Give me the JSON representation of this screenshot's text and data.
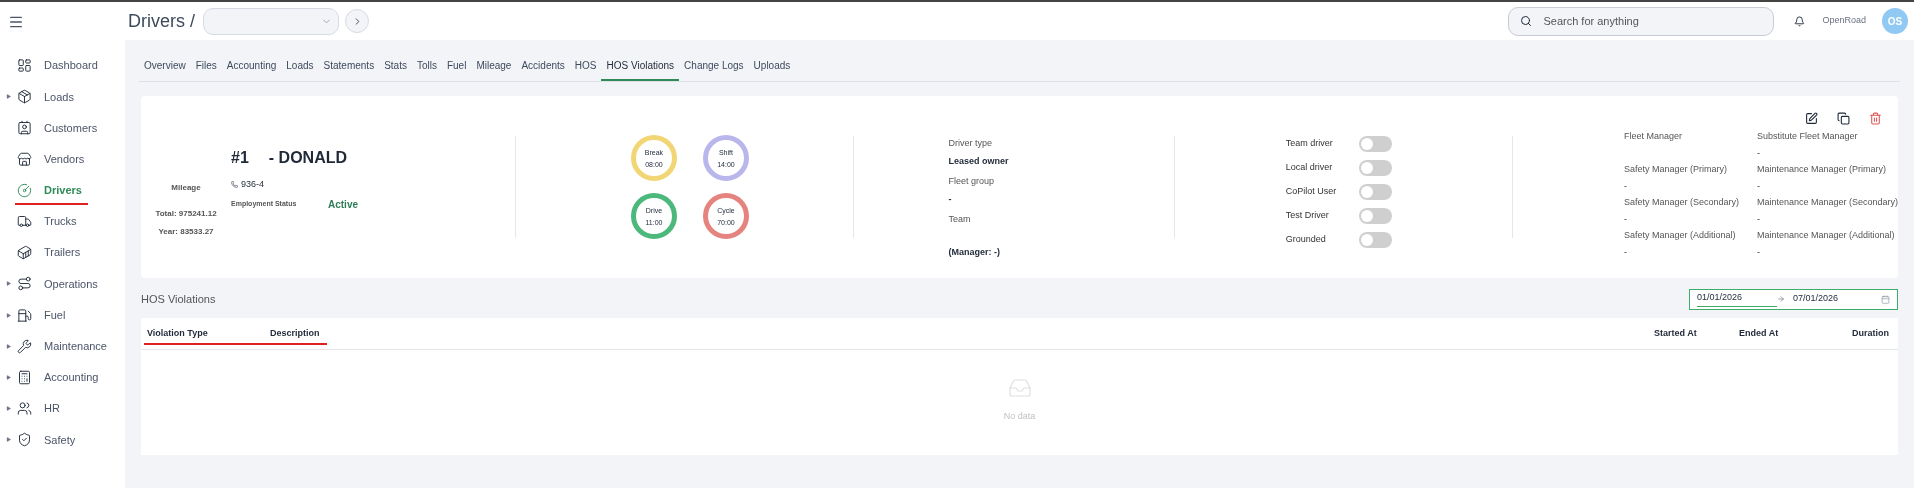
{
  "header": {
    "breadcrumb": "Drivers /",
    "search": {
      "placeholder": "Search for anything"
    },
    "company": "OpenRoad",
    "avatar_initials": "OS"
  },
  "sidebar": {
    "items": [
      {
        "label": "Dashboard",
        "expandable": false,
        "selected": false
      },
      {
        "label": "Loads",
        "expandable": true,
        "selected": false
      },
      {
        "label": "Customers",
        "expandable": false,
        "selected": false
      },
      {
        "label": "Vendors",
        "expandable": false,
        "selected": false
      },
      {
        "label": "Drivers",
        "expandable": false,
        "selected": true
      },
      {
        "label": "Trucks",
        "expandable": false,
        "selected": false
      },
      {
        "label": "Trailers",
        "expandable": false,
        "selected": false
      },
      {
        "label": "Operations",
        "expandable": true,
        "selected": false
      },
      {
        "label": "Fuel",
        "expandable": true,
        "selected": false
      },
      {
        "label": "Maintenance",
        "expandable": true,
        "selected": false
      },
      {
        "label": "Accounting",
        "expandable": true,
        "selected": false
      },
      {
        "label": "HR",
        "expandable": true,
        "selected": false
      },
      {
        "label": "Safety",
        "expandable": true,
        "selected": false
      }
    ]
  },
  "tabs": [
    {
      "label": "Overview",
      "selected": false
    },
    {
      "label": "Files",
      "selected": false
    },
    {
      "label": "Accounting",
      "selected": false
    },
    {
      "label": "Loads",
      "selected": false
    },
    {
      "label": "Statements",
      "selected": false
    },
    {
      "label": "Stats",
      "selected": false
    },
    {
      "label": "Tolls",
      "selected": false
    },
    {
      "label": "Fuel",
      "selected": false
    },
    {
      "label": "Mileage",
      "selected": false
    },
    {
      "label": "Accidents",
      "selected": false
    },
    {
      "label": "HOS",
      "selected": false
    },
    {
      "label": "HOS Violations",
      "selected": true
    },
    {
      "label": "Change Logs",
      "selected": false
    },
    {
      "label": "Uploads",
      "selected": false
    }
  ],
  "driver": {
    "name_prefix": "#1",
    "name": "- DONALD",
    "phone": "936-4",
    "employment_status_label": "Employment Status",
    "employment_status": "Active",
    "mileage_label": "Mileage",
    "mileage_total": "Total: 975241.12",
    "mileage_year": "Year: 83533.27"
  },
  "gauges": [
    {
      "label": "Break",
      "time": "08:00",
      "color": "#f2d675"
    },
    {
      "label": "Shift",
      "time": "14:00",
      "color": "#b9b6ec"
    },
    {
      "label": "Drive",
      "time": "11:00",
      "color": "#4cb87c"
    },
    {
      "label": "Cycle",
      "time": "70:00",
      "color": "#e5837f"
    }
  ],
  "details": [
    {
      "label": "Driver type",
      "value": "Leased owner"
    },
    {
      "label": "Fleet group",
      "value": "-"
    },
    {
      "label": "Team",
      "value": "(Manager: -)"
    }
  ],
  "toggles": [
    {
      "label": "Team driver",
      "on": false
    },
    {
      "label": "Local driver",
      "on": false
    },
    {
      "label": "CoPilot User",
      "on": false
    },
    {
      "label": "Test Driver",
      "on": false
    },
    {
      "label": "Grounded",
      "on": false
    }
  ],
  "managers": [
    {
      "label": "Fleet Manager"
    },
    {
      "label": "Substitute Fleet Manager",
      "value": "-"
    },
    {
      "label": "Safety Manager (Primary)",
      "value": "-"
    },
    {
      "label": "Maintenance Manager (Primary)",
      "value": "-"
    },
    {
      "label": "Safety Manager (Secondary)",
      "value": "-"
    },
    {
      "label": "Maintenance Manager (Secondary)",
      "value": "-"
    },
    {
      "label": "Safety Manager (Additional)",
      "value": "-"
    },
    {
      "label": "Maintenance Manager (Additional)",
      "value": "-"
    }
  ],
  "violations": {
    "title": "HOS Violations",
    "date_start": "01/01/2026",
    "date_end": "07/01/2026",
    "table": {
      "columns": [
        "Violation Type",
        "Description",
        "Started At",
        "Ended At",
        "Duration"
      ],
      "empty_text": "No data"
    }
  }
}
